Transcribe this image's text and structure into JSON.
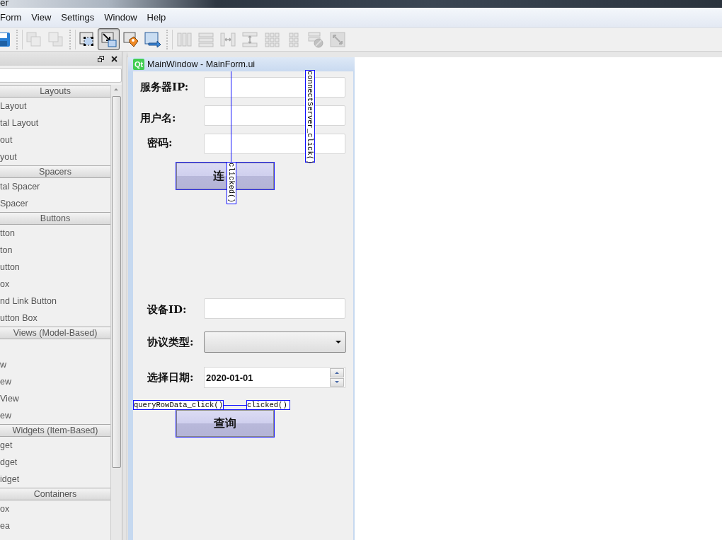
{
  "title_strip": {
    "text": "er"
  },
  "menu_bar": [
    "Form",
    "View",
    "Settings",
    "Window",
    "Help"
  ],
  "toolbar": [
    [
      {
        "kind": "save",
        "disabled": false,
        "selected": false
      }
    ],
    [
      {
        "kind": "raise",
        "disabled": true,
        "selected": false
      },
      {
        "kind": "lower",
        "disabled": true,
        "selected": false
      }
    ],
    [
      {
        "kind": "widget-edit",
        "disabled": false,
        "selected": false
      },
      {
        "kind": "signal-edit",
        "disabled": false,
        "selected": true
      },
      {
        "kind": "buddy-edit",
        "disabled": false,
        "selected": false
      },
      {
        "kind": "tab-order",
        "disabled": false,
        "selected": false
      }
    ],
    [
      {
        "kind": "h-layout",
        "disabled": true,
        "selected": false
      },
      {
        "kind": "v-layout",
        "disabled": true,
        "selected": false
      },
      {
        "kind": "h-split",
        "disabled": true,
        "selected": false
      },
      {
        "kind": "v-split",
        "disabled": true,
        "selected": false
      },
      {
        "kind": "grid",
        "disabled": true,
        "selected": false
      },
      {
        "kind": "form-layout",
        "disabled": true,
        "selected": false
      },
      {
        "kind": "break-layout",
        "disabled": true,
        "selected": false
      },
      {
        "kind": "adjust-size",
        "disabled": true,
        "selected": false
      }
    ]
  ],
  "widget_box": {
    "items": [
      {
        "kind": "category",
        "label": "Layouts"
      },
      {
        "kind": "item",
        "label": "Layout"
      },
      {
        "kind": "item",
        "label": "tal Layout"
      },
      {
        "kind": "item",
        "label": "out"
      },
      {
        "kind": "item",
        "label": "yout"
      },
      {
        "kind": "category",
        "label": "Spacers"
      },
      {
        "kind": "item",
        "label": "tal Spacer"
      },
      {
        "kind": "item",
        "label": "Spacer"
      },
      {
        "kind": "category",
        "label": "Buttons"
      },
      {
        "kind": "item",
        "label": "tton"
      },
      {
        "kind": "item",
        "label": "ton"
      },
      {
        "kind": "item",
        "label": "utton"
      },
      {
        "kind": "item",
        "label": "ox"
      },
      {
        "kind": "item",
        "label": "nd Link Button"
      },
      {
        "kind": "item",
        "label": "utton Box"
      },
      {
        "kind": "category",
        "label": "Views (Model-Based)"
      },
      {
        "kind": "item"
      },
      {
        "kind": "item",
        "label": "w"
      },
      {
        "kind": "item",
        "label": "ew"
      },
      {
        "kind": "item",
        "label": "View"
      },
      {
        "kind": "item",
        "label": "ew"
      },
      {
        "kind": "category",
        "label": "Widgets (Item-Based)"
      },
      {
        "kind": "item",
        "label": "get"
      },
      {
        "kind": "item",
        "label": "dget"
      },
      {
        "kind": "item",
        "label": "idget"
      },
      {
        "kind": "category",
        "label": "Containers"
      },
      {
        "kind": "item",
        "label": "ox"
      },
      {
        "kind": "item",
        "label": "ea"
      }
    ]
  },
  "form_window": {
    "logo": "Qt",
    "title": "MainWindow - MainForm.ui",
    "widgets": [
      {
        "kind": "label",
        "text": "服务器IP:"
      },
      {
        "kind": "line-edit"
      },
      {
        "kind": "label",
        "text": "用户名:"
      },
      {
        "kind": "line-edit"
      },
      {
        "kind": "label",
        "text": "密码:"
      },
      {
        "kind": "line-edit"
      },
      {
        "kind": "button",
        "text": "连"
      },
      {
        "kind": "label",
        "text": "设备ID:"
      },
      {
        "kind": "line-edit"
      },
      {
        "kind": "label",
        "text": "协议类型:"
      },
      {
        "kind": "combo"
      },
      {
        "kind": "label",
        "text": "选择日期:"
      },
      {
        "kind": "date-edit",
        "value": "2020-01-01"
      },
      {
        "kind": "button",
        "text": "查询"
      }
    ],
    "connections": [
      {
        "signal": "clicked()",
        "slot": "connectServer_click()"
      },
      {
        "signal": "clicked()",
        "slot": "queryRowData_click()"
      }
    ]
  }
}
